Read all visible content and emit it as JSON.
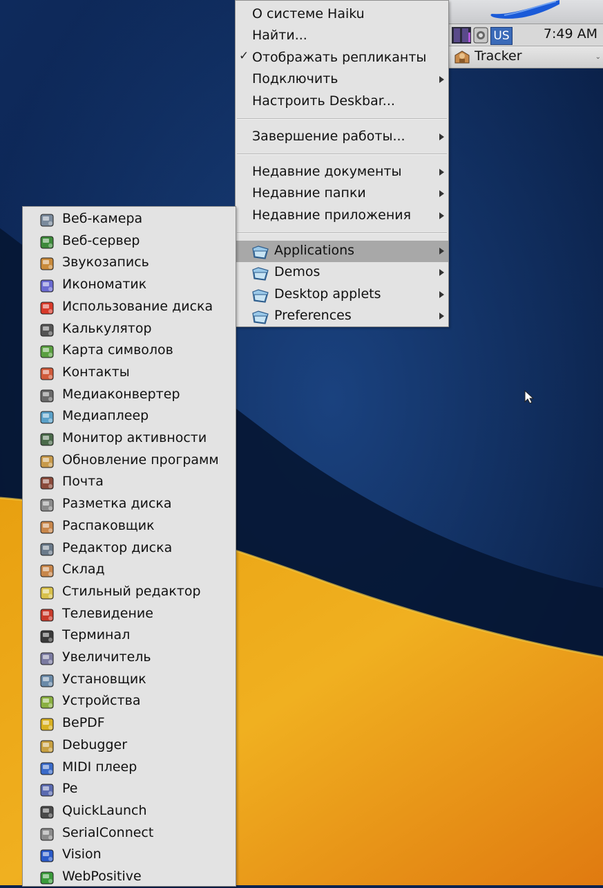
{
  "deskbar": {
    "keymap": "US",
    "clock": "7:49 AM",
    "tracker_label": "Tracker"
  },
  "main_menu": {
    "items": [
      {
        "label": "О системе Haiku"
      },
      {
        "label": "Найти..."
      },
      {
        "label": "Отображать репликанты",
        "checked": true
      },
      {
        "label": "Подключить",
        "submenu": true
      },
      {
        "label": "Настроить Deskbar..."
      },
      {
        "label": "Завершение работы...",
        "submenu": true
      },
      {
        "label": "Недавние документы",
        "submenu": true
      },
      {
        "label": "Недавние папки",
        "submenu": true
      },
      {
        "label": "Недавние приложения",
        "submenu": true
      },
      {
        "label": "Applications",
        "submenu": true,
        "selected": true,
        "icon": "folder-icon"
      },
      {
        "label": "Demos",
        "submenu": true,
        "icon": "folder-icon"
      },
      {
        "label": "Desktop applets",
        "submenu": true,
        "icon": "folder-icon"
      },
      {
        "label": "Preferences",
        "submenu": true,
        "icon": "folder-icon"
      }
    ]
  },
  "apps_menu": {
    "items": [
      {
        "label": "Веб-камера",
        "icon": "webcam-icon",
        "color": "#7a8a9c"
      },
      {
        "label": "Веб-сервер",
        "icon": "globe-icon",
        "color": "#3d8a3a"
      },
      {
        "label": "Звукозапись",
        "icon": "sound-recorder-icon",
        "color": "#c98a3a"
      },
      {
        "label": "Икономатик",
        "icon": "icon-editor-icon",
        "color": "#6a6ad0"
      },
      {
        "label": "Использование диска",
        "icon": "disk-usage-icon",
        "color": "#d83a2a"
      },
      {
        "label": "Калькулятор",
        "icon": "calculator-icon",
        "color": "#555555"
      },
      {
        "label": "Карта символов",
        "icon": "charmap-icon",
        "color": "#5aa040"
      },
      {
        "label": "Контакты",
        "icon": "contacts-icon",
        "color": "#d05a3a"
      },
      {
        "label": "Медиаконвертер",
        "icon": "media-converter-icon",
        "color": "#6a6a6a"
      },
      {
        "label": "Медиаплеер",
        "icon": "media-player-icon",
        "color": "#5aa0c8"
      },
      {
        "label": "Монитор активности",
        "icon": "activity-monitor-icon",
        "color": "#4a6a4a"
      },
      {
        "label": "Обновление программ",
        "icon": "software-updater-icon",
        "color": "#c89a4a"
      },
      {
        "label": "Почта",
        "icon": "mail-icon",
        "color": "#8a4a3a"
      },
      {
        "label": "Разметка диска",
        "icon": "drive-setup-icon",
        "color": "#8a8a8a"
      },
      {
        "label": "Распаковщик",
        "icon": "expander-icon",
        "color": "#c8864a"
      },
      {
        "label": "Редактор диска",
        "icon": "disk-probe-icon",
        "color": "#6a7a8a"
      },
      {
        "label": "Склад",
        "icon": "package-icon",
        "color": "#c8864a"
      },
      {
        "label": "Стильный редактор",
        "icon": "styled-edit-icon",
        "color": "#d8c04a"
      },
      {
        "label": "Телевидение",
        "icon": "tv-icon",
        "color": "#c83a2a"
      },
      {
        "label": "Терминал",
        "icon": "terminal-icon",
        "color": "#3a3a3a"
      },
      {
        "label": "Увеличитель",
        "icon": "magnify-icon",
        "color": "#7a7aa0"
      },
      {
        "label": "Установщик",
        "icon": "installer-icon",
        "color": "#6a8aa8"
      },
      {
        "label": "Устройства",
        "icon": "devices-icon",
        "color": "#8ab040"
      },
      {
        "label": "BePDF",
        "icon": "bepdf-icon",
        "color": "#d8b020"
      },
      {
        "label": "Debugger",
        "icon": "debugger-icon",
        "color": "#c8a040"
      },
      {
        "label": "MIDI плеер",
        "icon": "midi-player-icon",
        "color": "#3a6ac8"
      },
      {
        "label": "Pe",
        "icon": "pe-icon",
        "color": "#5a6ab0"
      },
      {
        "label": "QuickLaunch",
        "icon": "quicklaunch-icon",
        "color": "#4a4a4a"
      },
      {
        "label": "SerialConnect",
        "icon": "serial-connect-icon",
        "color": "#8a8a8a"
      },
      {
        "label": "Vision",
        "icon": "vision-icon",
        "color": "#2a5ac8"
      },
      {
        "label": "WebPositive",
        "icon": "webpositive-icon",
        "color": "#3a9a3a"
      }
    ]
  }
}
